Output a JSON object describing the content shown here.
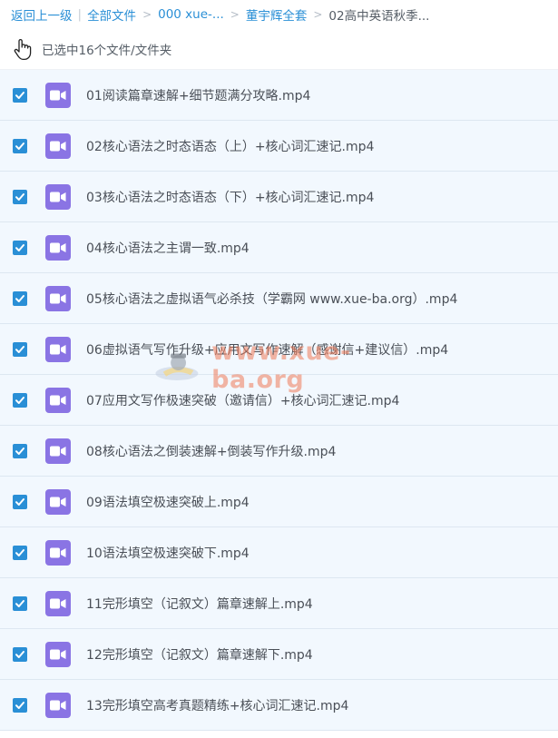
{
  "breadcrumb": {
    "back": "返回上一级",
    "all_files": "全部文件",
    "folder1": "000 xue-...",
    "folder2": "董宇辉全套",
    "current": "02高中英语秋季..."
  },
  "selection": {
    "text": "已选中16个文件/文件夹"
  },
  "files": [
    {
      "name": "01阅读篇章速解+细节题满分攻略.mp4",
      "checked": true,
      "icon": "video-file-icon"
    },
    {
      "name": "02核心语法之时态语态（上）+核心词汇速记.mp4",
      "checked": true,
      "icon": "video-file-icon"
    },
    {
      "name": "03核心语法之时态语态（下）+核心词汇速记.mp4",
      "checked": true,
      "icon": "video-file-icon"
    },
    {
      "name": "04核心语法之主谓一致.mp4",
      "checked": true,
      "icon": "video-file-icon"
    },
    {
      "name": "05核心语法之虚拟语气必杀技（学霸网 www.xue-ba.org）.mp4",
      "checked": true,
      "icon": "video-file-icon"
    },
    {
      "name": "06虚拟语气写作升级+应用文写作速解（感谢信+建议信）.mp4",
      "checked": true,
      "icon": "video-file-icon"
    },
    {
      "name": "07应用文写作极速突破（邀请信）+核心词汇速记.mp4",
      "checked": true,
      "icon": "video-file-icon"
    },
    {
      "name": "08核心语法之倒装速解+倒装写作升级.mp4",
      "checked": true,
      "icon": "video-file-icon"
    },
    {
      "name": "09语法填空极速突破上.mp4",
      "checked": true,
      "icon": "video-file-icon"
    },
    {
      "name": "10语法填空极速突破下.mp4",
      "checked": true,
      "icon": "video-file-icon"
    },
    {
      "name": "11完形填空（记叙文）篇章速解上.mp4",
      "checked": true,
      "icon": "video-file-icon"
    },
    {
      "name": "12完形填空（记叙文）篇章速解下.mp4",
      "checked": true,
      "icon": "video-file-icon"
    },
    {
      "name": "13完形填空高考真题精练+核心词汇速记.mp4",
      "checked": true,
      "icon": "video-file-icon"
    }
  ],
  "watermark": {
    "text": "www.xue-ba.org"
  },
  "colors": {
    "link": "#2a8fd6",
    "row_bg": "#f2f8fe",
    "checkbox": "#2a8fd6",
    "video_icon": "#8a74e4",
    "watermark": "#f07c5a"
  }
}
